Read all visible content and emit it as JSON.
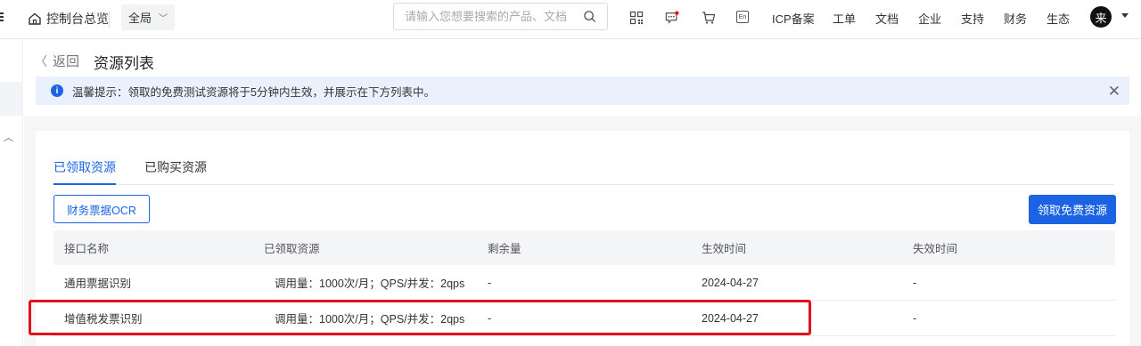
{
  "nav": {
    "home_label": "控制台总览",
    "region_label": "全局",
    "search_placeholder": "请输入您想要搜索的产品、文档",
    "links": [
      "ICP备案",
      "工单",
      "文档",
      "企业",
      "支持",
      "财务",
      "生态"
    ],
    "lang_badge": "En",
    "avatar_text": "来",
    "notification_dot_color": "#e3101b"
  },
  "page": {
    "back_label": "返回",
    "title": "资源列表",
    "notice": "温馨提示：领取的免费测试资源将于5分钟内生效，并展示在下方列表中。"
  },
  "tabs": [
    "已领取资源",
    "已购买资源"
  ],
  "filter_chip": "财务票据OCR",
  "primary_button": "领取免费资源",
  "table": {
    "headers": [
      "接口名称",
      "已领取资源",
      "剩余量",
      "生效时间",
      "失效时间"
    ],
    "rows": [
      [
        "通用票据识别",
        "调用量：1000次/月；QPS/并发：2qps",
        "-",
        "2024-04-27",
        "-"
      ],
      [
        "增值税发票识别",
        "调用量：1000次/月；QPS/并发：2qps",
        "-",
        "2024-04-27",
        "-"
      ]
    ]
  },
  "colors": {
    "accent": "#1b63e3",
    "highlight_border": "#e3101b"
  }
}
